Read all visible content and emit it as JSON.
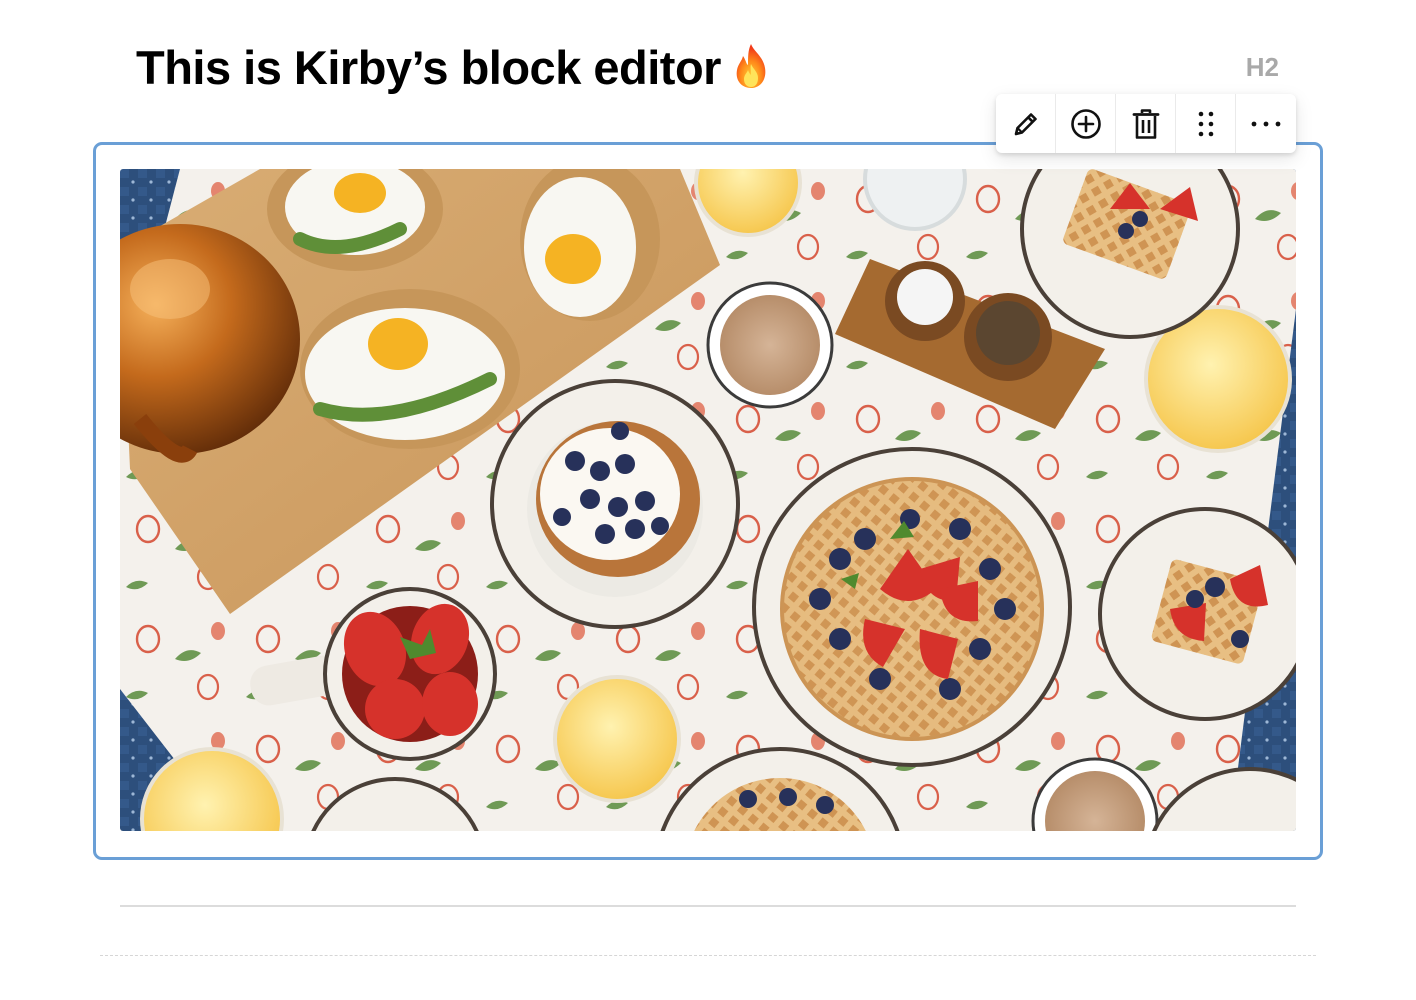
{
  "heading": {
    "text": "This is Kirby’s block editor",
    "icon": "fire-emoji",
    "level": "H2"
  },
  "toolbar": {
    "buttons": [
      {
        "name": "edit",
        "icon": "pencil-icon"
      },
      {
        "name": "add",
        "icon": "plus-circle-icon"
      },
      {
        "name": "delete",
        "icon": "trash-icon"
      },
      {
        "name": "drag",
        "icon": "drag-handle-icon"
      },
      {
        "name": "more",
        "icon": "more-icon"
      }
    ]
  },
  "image_block": {
    "subject": "Overhead breakfast table: waffles with berries, fried eggs on toast, coffee, orange juice, copper kettle",
    "selected": true
  },
  "colors": {
    "selection_border": "#6a9fd6",
    "level_label": "#a9a9a9",
    "heading": "#000000",
    "divider": "#dcdcdc"
  }
}
